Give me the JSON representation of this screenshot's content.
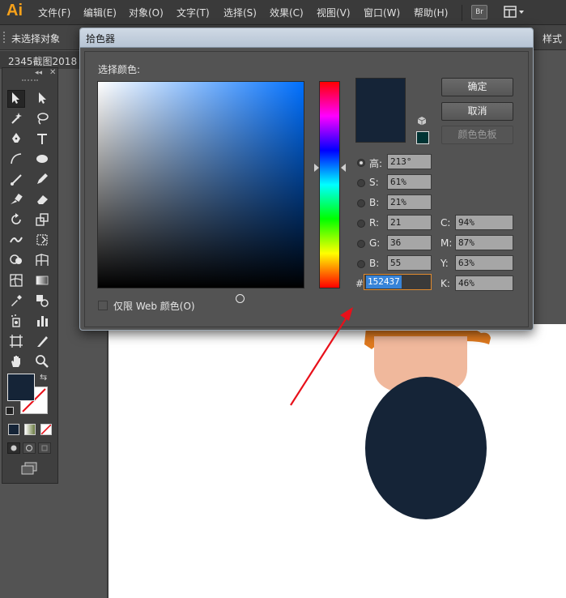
{
  "app": {
    "logo": "Ai"
  },
  "menu": [
    "文件(F)",
    "编辑(E)",
    "对象(O)",
    "文字(T)",
    "选择(S)",
    "效果(C)",
    "视图(V)",
    "窗口(W)",
    "帮助(H)"
  ],
  "top_buttons": {
    "bridge": "Br"
  },
  "controlbar": {
    "selection_status": "未选择对象",
    "style_label": "样式"
  },
  "document_tab": {
    "label": "2345截图2018"
  },
  "color_picker": {
    "title": "拾色器",
    "choose_label": "选择颜色:",
    "ok_label": "确定",
    "cancel_label": "取消",
    "swatches_label": "颜色色板",
    "fields": {
      "hsb": [
        {
          "label": "高:",
          "value": "213°",
          "selected": true
        },
        {
          "label": "S:",
          "value": "61%",
          "selected": false
        },
        {
          "label": "B:",
          "value": "21%",
          "selected": false
        }
      ],
      "rgb": [
        {
          "label": "R:",
          "value": "21"
        },
        {
          "label": "G:",
          "value": "36"
        },
        {
          "label": "B:",
          "value": "55"
        }
      ],
      "cmyk": [
        {
          "label": "C:",
          "value": "94%"
        },
        {
          "label": "M:",
          "value": "87%"
        },
        {
          "label": "Y:",
          "value": "63%"
        },
        {
          "label": "K:",
          "value": "46%"
        }
      ],
      "hex_label": "#",
      "hex_value": "152437"
    },
    "web_only_label": "仅限 Web 颜色(O)",
    "current_color": "#152437",
    "websafe_color": "#003333"
  },
  "colors": {
    "fill": "#152437",
    "skin": "#f0b89c",
    "hair": "#e07a1f",
    "arrow": "#e8101a"
  },
  "icons": [
    "selection-tool-icon",
    "direct-selection-tool-icon",
    "magic-wand-icon",
    "lasso-icon",
    "pen-tool-icon",
    "type-tool-icon",
    "line-tool-icon",
    "ellipse-tool-icon",
    "paintbrush-icon",
    "pencil-icon",
    "blob-brush-icon",
    "eraser-icon",
    "rotate-icon",
    "scale-icon",
    "warp-icon",
    "free-transform-icon",
    "shape-builder-icon",
    "perspective-grid-icon",
    "mesh-icon",
    "gradient-icon",
    "eyedropper-icon",
    "blend-icon",
    "symbol-sprayer-icon",
    "column-graph-icon",
    "artboard-icon",
    "slice-icon",
    "hand-icon",
    "zoom-icon"
  ]
}
